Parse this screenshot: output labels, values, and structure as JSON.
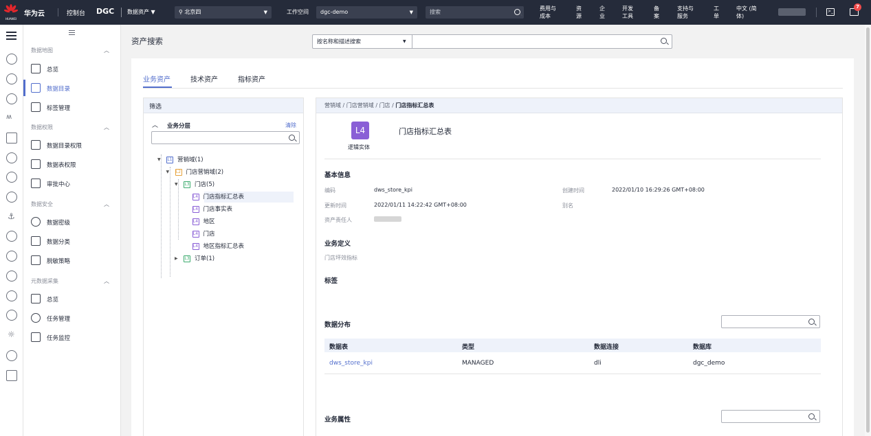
{
  "topbar": {
    "brand": "华为云",
    "logo_text": "HUAWEI",
    "console": "控制台",
    "product": "DGC",
    "module": "数据资产",
    "region": "北京四",
    "workspace_label": "工作空间",
    "workspace_value": "dgc-demo",
    "search_placeholder": "搜索",
    "links": [
      {
        "l1": "费用与",
        "l2": "成本"
      },
      {
        "l1": "资",
        "l2": "源"
      },
      {
        "l1": "企",
        "l2": "业"
      },
      {
        "l1": "开发",
        "l2": "工具"
      },
      {
        "l1": "备",
        "l2": "案"
      },
      {
        "l1": "支持与",
        "l2": "服务"
      },
      {
        "l1": "工",
        "l2": "单"
      },
      {
        "l1": "中文 (简",
        "l2": "体)"
      }
    ],
    "notif_count": "7"
  },
  "menu": {
    "sections": [
      {
        "title": "数据地图",
        "items": [
          "总览",
          "数据目录",
          "标签管理"
        ]
      },
      {
        "title": "数据权限",
        "items": [
          "数据目录权限",
          "数据表权限",
          "审批中心"
        ]
      },
      {
        "title": "数据安全",
        "items": [
          "数据密级",
          "数据分类",
          "脱敏策略"
        ]
      },
      {
        "title": "元数据采集",
        "items": [
          "总览",
          "任务管理",
          "任务监控"
        ]
      }
    ],
    "active_item": "数据目录"
  },
  "page": {
    "title": "资产搜索",
    "search_mode": "按名称和描述搜索",
    "tabs": [
      "业务资产",
      "技术资产",
      "指标资产"
    ],
    "active_tab": "业务资产"
  },
  "filter": {
    "header": "筛选",
    "group_title": "业务分层",
    "clear": "清除",
    "tree": [
      {
        "level": "L1",
        "label": "营销域(1)",
        "depth": 0,
        "toggle": "▼"
      },
      {
        "level": "L2",
        "label": "门店营销域(2)",
        "depth": 1,
        "toggle": "▼"
      },
      {
        "level": "L3",
        "label": "门店(5)",
        "depth": 2,
        "toggle": "▼"
      },
      {
        "level": "L4",
        "label": "门店指标汇总表",
        "depth": 3,
        "toggle": ""
      },
      {
        "level": "L4",
        "label": "门店事实表",
        "depth": 3,
        "toggle": ""
      },
      {
        "level": "L4",
        "label": "地区",
        "depth": 3,
        "toggle": ""
      },
      {
        "level": "L4",
        "label": "门店",
        "depth": 3,
        "toggle": ""
      },
      {
        "level": "L4",
        "label": "地区指标汇总表",
        "depth": 3,
        "toggle": ""
      },
      {
        "level": "L3",
        "label": "订单(1)",
        "depth": 2,
        "toggle": "▶"
      }
    ],
    "selected": "门店指标汇总表"
  },
  "detail": {
    "breadcrumb": [
      "营销域",
      "门店营销域",
      "门店",
      "门店指标汇总表"
    ],
    "entity_badge": "L4",
    "entity_type": "逻辑实体",
    "entity_name": "门店指标汇总表",
    "basic_info_title": "基本信息",
    "fields": {
      "code_label": "编码",
      "code_value": "dws_store_kpi",
      "created_label": "创建时间",
      "created_value": "2022/01/10 16:29:26 GMT+08:00",
      "updated_label": "更新时间",
      "updated_value": "2022/01/11 14:22:42 GMT+08:00",
      "alias_label": "别名",
      "alias_value": "",
      "owner_label": "资产责任人"
    },
    "biz_def_title": "业务定义",
    "biz_def_value": "门店坪效指标",
    "tags_title": "标签",
    "distribution_title": "数据分布",
    "table_headers": [
      "数据表",
      "类型",
      "数据连接",
      "数据库"
    ],
    "table_rows": [
      [
        "dws_store_kpi",
        "MANAGED",
        "dli",
        "dgc_demo"
      ]
    ],
    "biz_attr_title": "业务属性"
  },
  "colors": {
    "accent": "#526ecc",
    "topbar": "#252b3a",
    "l1": "#526ecc",
    "l2": "#e6a23c",
    "l3": "#3cab6e",
    "l4": "#8a5fd6",
    "badge": "#f04b4b"
  }
}
